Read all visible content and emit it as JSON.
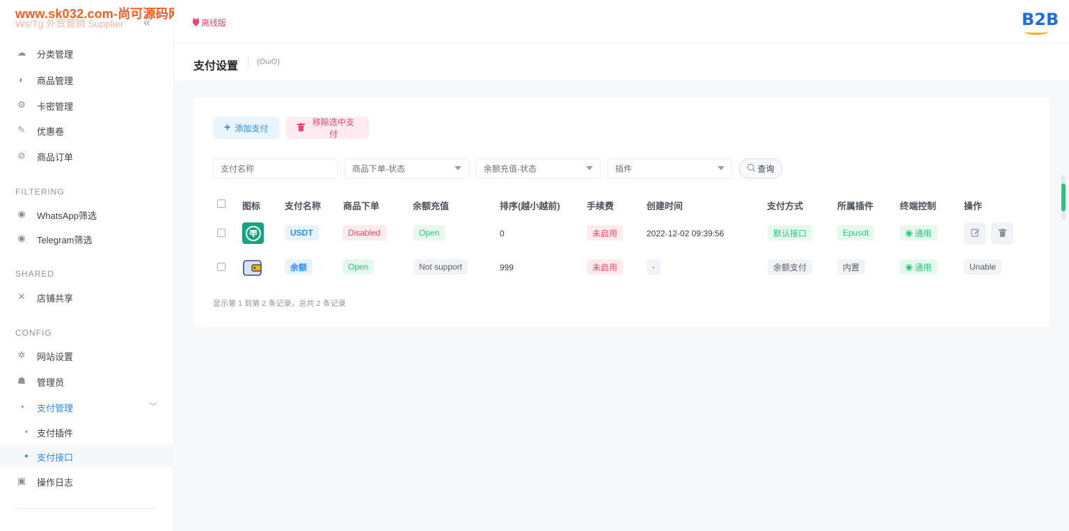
{
  "watermark": {
    "line1": "www.sk032.com-尚可源码网",
    "line2": "Ws/Tg 外贸营销 Supplier"
  },
  "sidebar": {
    "collapse_icon": "«",
    "items": [
      {
        "label": "分类管理",
        "icon": "folder-icon"
      },
      {
        "label": "商品管理",
        "icon": "product-icon"
      },
      {
        "label": "卡密管理",
        "icon": "key-icon"
      },
      {
        "label": "优惠卷",
        "icon": "coupon-icon"
      },
      {
        "label": "商品订单",
        "icon": "order-icon"
      }
    ],
    "sections": {
      "filtering": "FILTERING",
      "shared": "SHARED",
      "config": "CONFIG"
    },
    "filtering_items": [
      {
        "label": "WhatsApp筛选"
      },
      {
        "label": "Telegram筛选"
      }
    ],
    "shared_items": [
      {
        "label": "店铺共享"
      }
    ],
    "config_items": [
      {
        "label": "网站设置"
      },
      {
        "label": "管理员"
      },
      {
        "label": "支付管理"
      }
    ],
    "pay_sub": [
      {
        "label": "支付插件"
      },
      {
        "label": "支付接口"
      }
    ],
    "log_item": {
      "label": "操作日志"
    }
  },
  "header": {
    "offline_label": "离线版",
    "logo_text": "B2B"
  },
  "page": {
    "title": "支付设置",
    "face": "(ʘωʘ)"
  },
  "toolbar": {
    "add_label": "添加支付",
    "remove_label": "移除选中支付"
  },
  "filters": {
    "name_placeholder": "支付名称",
    "order_status": "商品下单-状态",
    "recharge_status": "余额充值-状态",
    "plugin": "插件",
    "search_label": "查询"
  },
  "table": {
    "headers": [
      "图标",
      "支付名称",
      "商品下单",
      "余额充值",
      "排序(越小越前)",
      "手续费",
      "创建时间",
      "支付方式",
      "所属插件",
      "终端控制",
      "操作"
    ],
    "rows": [
      {
        "name": "USDT",
        "order": "Disabled",
        "recharge": "Open",
        "sort": "0",
        "fee": "未启用",
        "created": "2022-12-02 09:39:56",
        "method": "默认接口",
        "plugin": "Epusdt",
        "terminal": "通用",
        "action": ""
      },
      {
        "name": "余额",
        "order": "Open",
        "recharge": "Not support",
        "sort": "999",
        "fee": "未启用",
        "created": "-",
        "method": "余额支付",
        "plugin": "内置",
        "terminal": "通用",
        "action": "Unable"
      }
    ],
    "footer": "显示第 1 到第 2 条记录，总共 2 条记录"
  },
  "colors": {
    "accent": "#2b8cf6",
    "danger": "#f0446a",
    "success": "#2ec27e",
    "usdt": "#13a57c"
  }
}
